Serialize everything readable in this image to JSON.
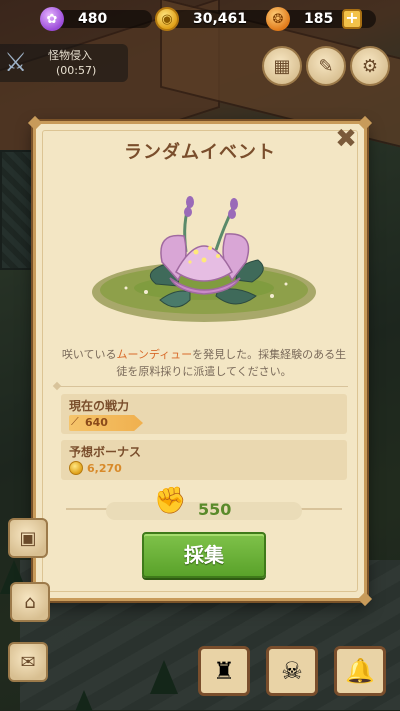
{
  "resources": {
    "gems": "480",
    "coins": "30,461",
    "seeds": "185",
    "plus_label": "+"
  },
  "invasion": {
    "title": "怪物侵入",
    "timer": "(00:57)"
  },
  "dialog": {
    "title": "ランダムイベント",
    "close_label": "✖",
    "description_prefix": "咲いている",
    "description_highlight": "ムーンディュー",
    "description_suffix": "を発見した。採集経験のある生徒を原料採りに派遣してください。",
    "power": {
      "label": "現在の戦力",
      "value": "640"
    },
    "bonus": {
      "label": "予想ボーナス",
      "value": "6,270"
    },
    "cost": "550",
    "gather_button": "採集"
  },
  "colors": {
    "panel": "#f3e6c4",
    "border": "#c89b5a",
    "title": "#7a4e2c",
    "highlight": "#d86a2a",
    "gather_button": "#6cb43a"
  },
  "icons": {
    "gem": "purple-flower-gem-icon",
    "coin": "gold-coin-icon",
    "seed": "orange-seed-icon",
    "power": "sword-icon",
    "cost": "fist-icon",
    "close": "close-icon"
  }
}
